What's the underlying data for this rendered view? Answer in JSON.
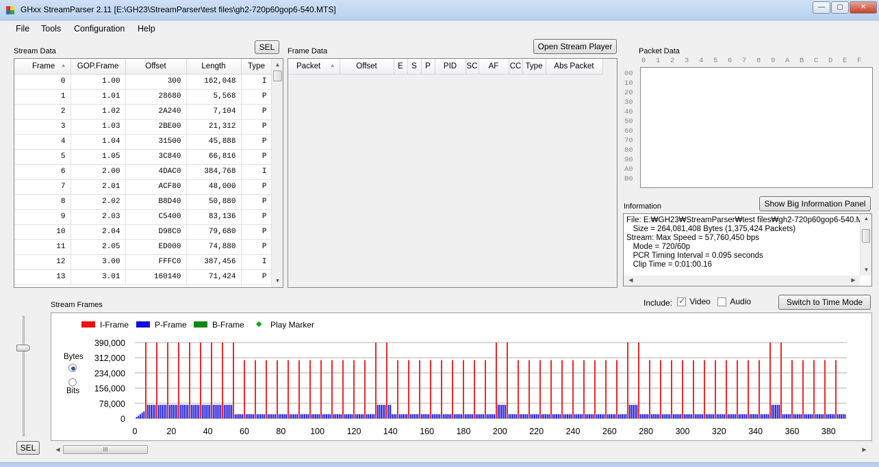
{
  "window": {
    "title": "GHxx StreamParser 2.11 [E:\\GH23\\StreamParser\\test files\\gh2-720p60gop6-540.MTS]",
    "minimize_glyph": "—",
    "maximize_glyph": "▢",
    "close_glyph": "✕"
  },
  "menu": [
    "File",
    "Tools",
    "Configuration",
    "Help"
  ],
  "stream_data": {
    "label": "Stream Data",
    "sel_button": "SEL",
    "columns": [
      "Frame",
      "GOP.Frame",
      "Offset",
      "Length",
      "Type"
    ],
    "rows": [
      [
        "0",
        "1.00",
        "300",
        "162,048",
        "I"
      ],
      [
        "1",
        "1.01",
        "28680",
        "5,568",
        "P"
      ],
      [
        "2",
        "1.02",
        "2A240",
        "7,104",
        "P"
      ],
      [
        "3",
        "1.03",
        "2BE00",
        "21,312",
        "P"
      ],
      [
        "4",
        "1.04",
        "31500",
        "45,888",
        "P"
      ],
      [
        "5",
        "1.05",
        "3C840",
        "66,816",
        "P"
      ],
      [
        "6",
        "2.00",
        "4DAC0",
        "384,768",
        "I"
      ],
      [
        "7",
        "2.01",
        "ACF80",
        "48,000",
        "P"
      ],
      [
        "8",
        "2.02",
        "B8D40",
        "50,880",
        "P"
      ],
      [
        "9",
        "2.03",
        "C5400",
        "83,136",
        "P"
      ],
      [
        "10",
        "2.04",
        "D98C0",
        "79,680",
        "P"
      ],
      [
        "11",
        "2.05",
        "ED000",
        "74,880",
        "P"
      ],
      [
        "12",
        "3.00",
        "FFFC0",
        "387,456",
        "I"
      ],
      [
        "13",
        "3.01",
        "160140",
        "71,424",
        "P"
      ]
    ]
  },
  "frame_data": {
    "label": "Frame Data",
    "open_player_button": "Open Stream Player",
    "columns": [
      "Packet",
      "Offset",
      "E",
      "S",
      "P",
      "PID",
      "SC",
      "AF",
      "CC",
      "Type",
      "Abs Packet"
    ]
  },
  "packet_data": {
    "label": "Packet Data",
    "col_headers": [
      "0",
      "1",
      "2",
      "3",
      "4",
      "5",
      "6",
      "7",
      "8",
      "9",
      "A",
      "B",
      "C",
      "D",
      "E",
      "F"
    ],
    "row_headers": [
      "00",
      "10",
      "20",
      "30",
      "40",
      "50",
      "60",
      "70",
      "80",
      "90",
      "A0",
      "B0"
    ]
  },
  "information": {
    "label": "Information",
    "big_panel_button": "Show Big Information Panel",
    "lines": [
      "File: E:₩GH23₩StreamParser₩test files₩gh2-720p60gop6-540.MTS",
      "   Size = 264,081,408 Bytes (1,375,424 Packets)",
      "Stream: Max Speed = 57,760,450 bps",
      "   Mode = 720/60p",
      "   PCR Timing Interval = 0.095 seconds",
      "   Clip Time = 0:01:00.16"
    ]
  },
  "stream_frames": {
    "label": "Stream Frames",
    "include_label": "Include:",
    "video_label": "Video",
    "video_checked": true,
    "audio_label": "Audio",
    "audio_checked": false,
    "switch_button": "Switch to Time Mode",
    "bytes_label": "Bytes",
    "bits_label": "Bits",
    "unit_selected": "Bytes",
    "sel_button": "SEL",
    "scroll_grip": "III",
    "legend": [
      {
        "name": "I-Frame",
        "color": "#ee1111"
      },
      {
        "name": "P-Frame",
        "color": "#1010dd"
      },
      {
        "name": "B-Frame",
        "color": "#118811"
      },
      {
        "name": "Play Marker",
        "color": "#11aa11"
      }
    ]
  },
  "chart_data": {
    "type": "bar",
    "ylim": [
      0,
      390000
    ],
    "yticks": [
      "390,000",
      "312,000",
      "234,000",
      "156,000",
      "78,000",
      "0"
    ],
    "ytick_values": [
      390000,
      312000,
      234000,
      156000,
      78000,
      0
    ],
    "xlim": [
      0,
      390
    ],
    "xticks": [
      0,
      20,
      40,
      60,
      80,
      100,
      120,
      140,
      160,
      180,
      200,
      220,
      240,
      260,
      280,
      300,
      320,
      340,
      360,
      380
    ],
    "grid": true,
    "i_frame_interval": 6,
    "frame_count": 390,
    "i_frame_values_high": 390000,
    "i_frame_values_normal": 300000,
    "p_frame_values_high": 70000,
    "p_frame_values_normal": 22000,
    "high_segments": [
      [
        6,
        54
      ],
      [
        132,
        140
      ],
      [
        198,
        204
      ],
      [
        270,
        276
      ],
      [
        348,
        354
      ]
    ]
  }
}
